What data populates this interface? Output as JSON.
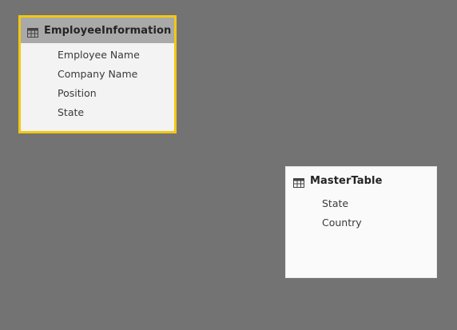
{
  "tables": [
    {
      "name": "EmployeeInformation",
      "icon": "table-icon",
      "selected": true,
      "fields": [
        "Employee Name",
        "Company Name",
        "Position",
        "State"
      ]
    },
    {
      "name": "MasterTable",
      "icon": "table-icon",
      "selected": false,
      "fields": [
        "State",
        "Country"
      ]
    }
  ],
  "colors": {
    "canvas": "#737373",
    "selection_border": "#f2c811",
    "selected_header": "#a9a9a9"
  }
}
